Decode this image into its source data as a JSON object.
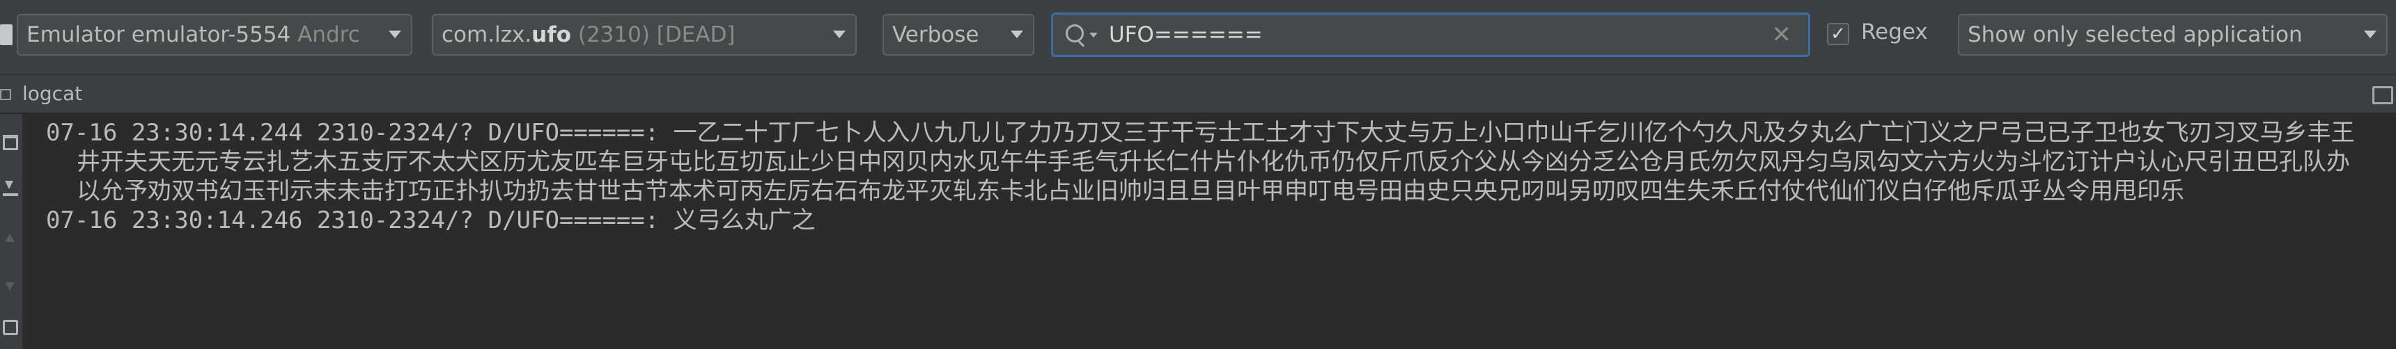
{
  "toolbar": {
    "device": {
      "name": "Emulator emulator-5554",
      "os": "Andrc"
    },
    "process": {
      "prefix": "com.lzx.",
      "app": "ufo",
      "suffix": " (2310) [DEAD]"
    },
    "log_level": "Verbose",
    "search": {
      "value": "UFO======"
    },
    "regex": {
      "checked": true,
      "checkmark": "✓",
      "label": "Regex"
    },
    "filter": "Show only selected application"
  },
  "panel": {
    "title": "logcat"
  },
  "log": {
    "entries": [
      {
        "header": "07-16 23:30:14.244 2310-2324/? D/UFO======: ",
        "message": "一乙二十丁厂七卜人入八九几儿了力乃刀又三于干亏士工土才寸下大丈与万上小口巾山千乞川亿个勺久凡及夕丸么广亡门义之尸弓己已子卫也女飞刃习叉马乡丰王井开夫天无元专云扎艺木五支厅不太犬区历尤友匹车巨牙屯比互切瓦止少日中冈贝内水见午牛手毛气升长仁什片仆化仇币仍仅斤爪反介父从今凶分乏公仓月氏勿欠风丹匀乌凤勾文六方火为斗忆订计户认心尺引丑巴孔队办以允予劝双书幻玉刊示末未击打巧正扑扒功扔去甘世古节本术可丙左厉右石布龙平灭轧东卡北占业旧帅归且旦目叶甲申叮电号田由史只央兄叼叫另叨叹四生失禾丘付仗代仙们仪白仔他斥瓜乎丛令用甩印乐"
      },
      {
        "header": "07-16 23:30:14.246 2310-2324/? D/UFO======: ",
        "message": "义弓么丸广之"
      }
    ]
  },
  "colors": {
    "background": "#2b2b2b",
    "toolbar": "#3c3f41",
    "text": "#bbbbbb",
    "accent": "#3b6ea8"
  },
  "icons": [
    "device-icon",
    "search-icon",
    "clear-icon",
    "logcat-icon",
    "layout-icon",
    "trash-icon",
    "scroll-to-end-icon",
    "up-arrow-icon",
    "down-arrow-icon",
    "soft-wrap-icon"
  ]
}
